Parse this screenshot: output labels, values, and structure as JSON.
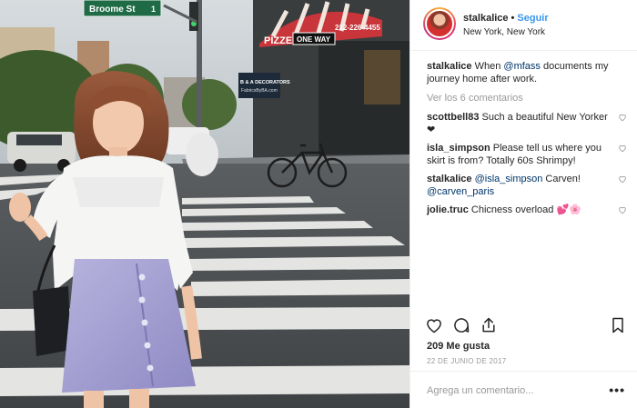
{
  "photo": {
    "street_sign": "Broome St",
    "sign_suffix": "1",
    "pizzeria_sign": "PIZZERIA",
    "pizzeria_phone": "212-226-4455",
    "one_way_sign": "ONE WAY",
    "shop_sign_line1": "B & A DECORATORS",
    "shop_sign_line2": "FabricsByBA.com"
  },
  "header": {
    "username": "stalkalice",
    "separator": "•",
    "follow_label": "Seguir",
    "location": "New York, New York"
  },
  "caption": {
    "username": "stalkalice",
    "text_before": "When ",
    "mention": "@mfass",
    "text_after": " documents my journey home after work."
  },
  "view_all_label": "Ver los 6 comentarios",
  "comments": [
    {
      "username": "scottbell83",
      "text": "Such a beautiful New Yorker ❤"
    },
    {
      "username": "isla_simpson",
      "text": "Please tell us where you skirt is from? Totally 60s Shrimpy!"
    },
    {
      "username": "stalkalice",
      "mention": "@isla_simpson",
      "text": " Carven! ",
      "mention2": "@carven_paris"
    },
    {
      "username": "jolie.truc",
      "text": "Chicness overload 💕🌸"
    }
  ],
  "actions": {
    "icons": [
      "heart-icon",
      "comment-icon",
      "share-icon",
      "bookmark-icon"
    ]
  },
  "likes_label": "209 Me gusta",
  "date_label": "22 DE JUNIO DE 2017",
  "add_comment": {
    "placeholder": "Agrega un comentario...",
    "more_label": "•••"
  },
  "colors": {
    "link": "#3897f0",
    "mention": "#003569",
    "muted": "#999999",
    "text": "#262626"
  }
}
